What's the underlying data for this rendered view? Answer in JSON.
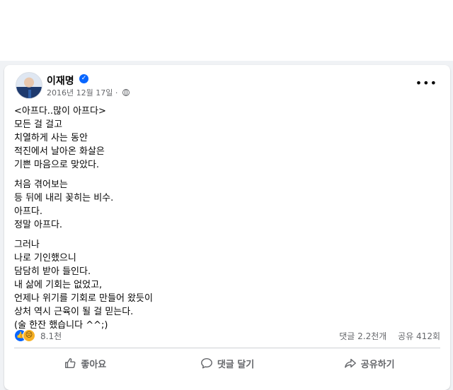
{
  "post": {
    "author": "이재명",
    "date": "2016년 12월 17일",
    "privacy_icon": "globe-icon",
    "paragraphs": [
      [
        "<아프다..많이 아프다>",
        "모든 걸 걸고",
        "치열하게 사는 동안",
        "적진에서 날아온 화살은",
        "기쁜 마음으로 맞았다."
      ],
      [
        "처음 겪어보는",
        "등 뒤에 내리 꽂히는 비수.",
        "아프다.",
        "정말 아프다."
      ],
      [
        "그러나",
        "나로 기인했으니",
        "담담히 받아 들인다.",
        "내 삶에 기회는 없었고,",
        "언제나 위기를 기회로 만들어 왔듯이",
        "상처 역시 근육이 될 걸 믿는다.",
        "(술 한잔 했습니다 ^^;)"
      ]
    ]
  },
  "stats": {
    "reactions_count": "8.1천",
    "comments": "댓글 2.2천개",
    "shares": "공유 412회"
  },
  "actions": {
    "like": "좋아요",
    "comment": "댓글 달기",
    "share": "공유하기"
  },
  "colors": {
    "accent": "#0866ff",
    "secondary_text": "#65676b",
    "page_bg": "#f0f2f5"
  }
}
